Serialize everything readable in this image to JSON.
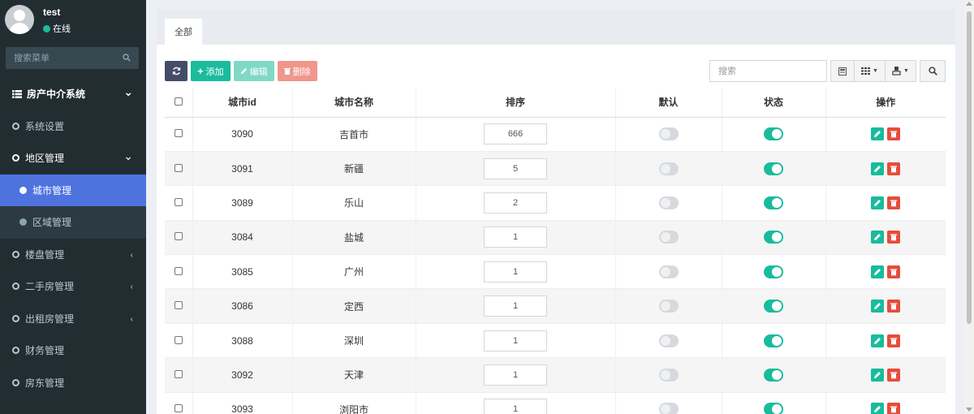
{
  "user": {
    "name": "test",
    "status": "在线"
  },
  "sidebar": {
    "search_placeholder": "搜索菜单",
    "items": [
      {
        "label": "房产中介系统",
        "type": "header",
        "caret": "⌄"
      },
      {
        "label": "系统设置",
        "type": "item"
      },
      {
        "label": "地区管理",
        "type": "open",
        "caret": "⌄"
      },
      {
        "label": "城市管理",
        "type": "sub-active"
      },
      {
        "label": "区域管理",
        "type": "sub"
      },
      {
        "label": "楼盘管理",
        "type": "item",
        "caret": "‹"
      },
      {
        "label": "二手房管理",
        "type": "item",
        "caret": "‹"
      },
      {
        "label": "出租房管理",
        "type": "item",
        "caret": "‹"
      },
      {
        "label": "财务管理",
        "type": "item"
      },
      {
        "label": "房东管理",
        "type": "item"
      }
    ]
  },
  "tabs": {
    "active": "全部"
  },
  "toolbar": {
    "refresh_icon": "refresh-icon",
    "add_label": "添加",
    "edit_label": "编辑",
    "delete_label": "删除",
    "search_placeholder": "搜索"
  },
  "table": {
    "columns": [
      "城市id",
      "城市名称",
      "排序",
      "默认",
      "状态",
      "操作"
    ],
    "rows": [
      {
        "id": "3090",
        "name": "吉首市",
        "sort": "666",
        "default": false,
        "status": true
      },
      {
        "id": "3091",
        "name": "新疆",
        "sort": "5",
        "default": false,
        "status": true
      },
      {
        "id": "3089",
        "name": "乐山",
        "sort": "2",
        "default": false,
        "status": true
      },
      {
        "id": "3084",
        "name": "盐城",
        "sort": "1",
        "default": false,
        "status": true
      },
      {
        "id": "3085",
        "name": "广州",
        "sort": "1",
        "default": false,
        "status": true
      },
      {
        "id": "3086",
        "name": "定西",
        "sort": "1",
        "default": false,
        "status": true
      },
      {
        "id": "3088",
        "name": "深圳",
        "sort": "1",
        "default": false,
        "status": true
      },
      {
        "id": "3092",
        "name": "天津",
        "sort": "1",
        "default": false,
        "status": true
      },
      {
        "id": "3093",
        "name": "浏阳市",
        "sort": "1",
        "default": false,
        "status": true
      }
    ]
  },
  "colors": {
    "sidebar_bg": "#222d32",
    "active": "#4e73df",
    "success": "#18bc9c",
    "danger": "#e74c3c"
  }
}
